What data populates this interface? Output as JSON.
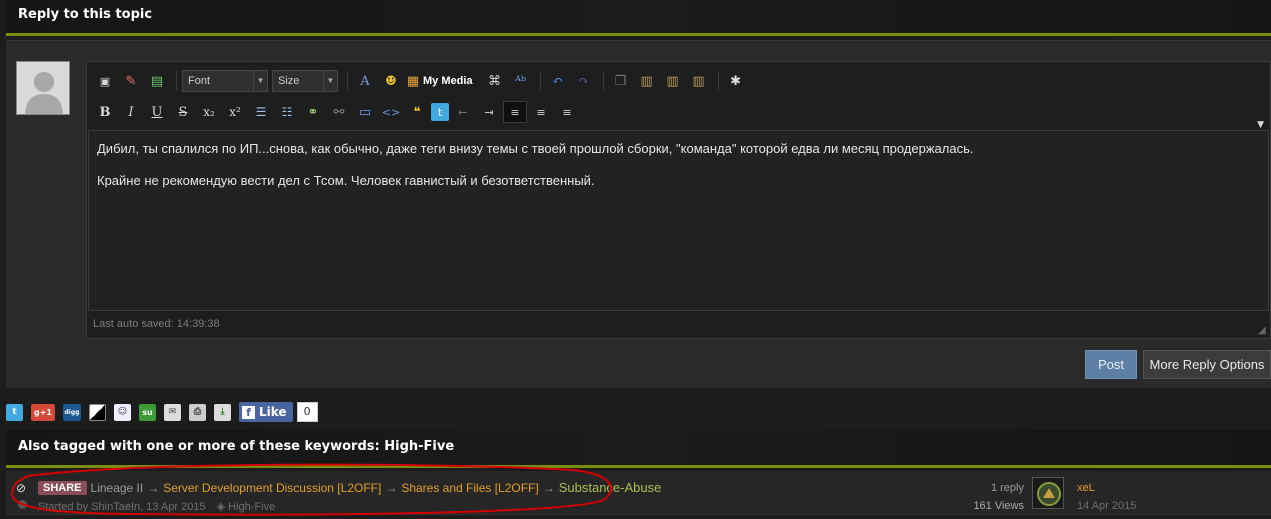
{
  "header": {
    "title": "Reply to this topic"
  },
  "editor": {
    "font_label": "Font",
    "size_label": "Size",
    "my_media_label": "My Media",
    "content": [
      "Дибил, ты спалился по ИП...снова, как обычно, даже теги внизу темы с твоей прошлой сборки, \"команда\" которой едва ли месяц продержалась.",
      "Крайне не рекомендую вести дел с Тсом. Человек гавнистый и безответственный."
    ],
    "autosave": "Last auto saved: 14:39:38"
  },
  "actions": {
    "post_label": "Post",
    "more_label": "More Reply Options"
  },
  "share": {
    "gplus_label": "g+1",
    "digg_label": "digg",
    "su_label": "su",
    "like_label": "Like",
    "like_count": "0"
  },
  "keywords": {
    "title": "Also tagged with one or more of these keywords: High-Five"
  },
  "topic": {
    "prefix": "SHARE",
    "breadcrumb_1": "Lineage II",
    "breadcrumb_2": "Server Development Discussion [L2OFF]",
    "breadcrumb_3": "Shares and Files [L2OFF]",
    "title": "Substance-Abuse",
    "started_by": "Started by ShinTaeIn, 13 Apr 2015",
    "tag": "High-Five",
    "replies": "1 reply",
    "views": "161 Views",
    "last_user": "xeL",
    "last_date": "14 Apr 2015"
  },
  "colors": {
    "accent_bar": "#7a8f10",
    "post_button": "#5d7fa6",
    "link_orange": "#e39e2b",
    "title_green": "#a8c050",
    "annotation_red": "#d40000"
  }
}
